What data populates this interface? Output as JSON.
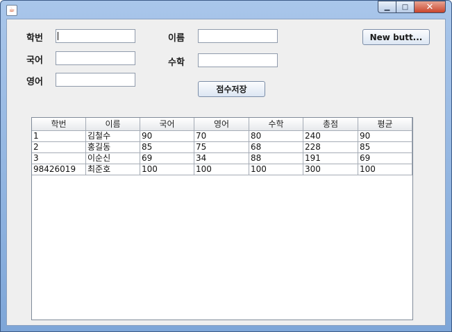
{
  "window": {
    "title": "",
    "buttons": {
      "minimize": "▁",
      "maximize": "□",
      "close": "✕"
    }
  },
  "form": {
    "student_id_label": "학번",
    "name_label": "이름",
    "korean_label": "국어",
    "math_label": "수학",
    "english_label": "영어",
    "student_id_value": "",
    "name_value": "",
    "korean_value": "",
    "math_value": "",
    "english_value": "",
    "save_button": "점수저장",
    "new_button": "New butt..."
  },
  "table": {
    "headers": [
      "학번",
      "이름",
      "국어",
      "영어",
      "수학",
      "총점",
      "평균"
    ],
    "rows": [
      [
        "1",
        "김철수",
        "90",
        "70",
        "80",
        "240",
        "90"
      ],
      [
        "2",
        "홍길동",
        "85",
        "75",
        "68",
        "228",
        "85"
      ],
      [
        "3",
        "이순신",
        "69",
        "34",
        "88",
        "191",
        "69"
      ],
      [
        "98426019",
        "최준호",
        "100",
        "100",
        "100",
        "300",
        "100"
      ]
    ]
  },
  "colors": {
    "title_bar": "#7ea6d8",
    "panel_bg": "#efefef",
    "close_button": "#c9452d"
  }
}
